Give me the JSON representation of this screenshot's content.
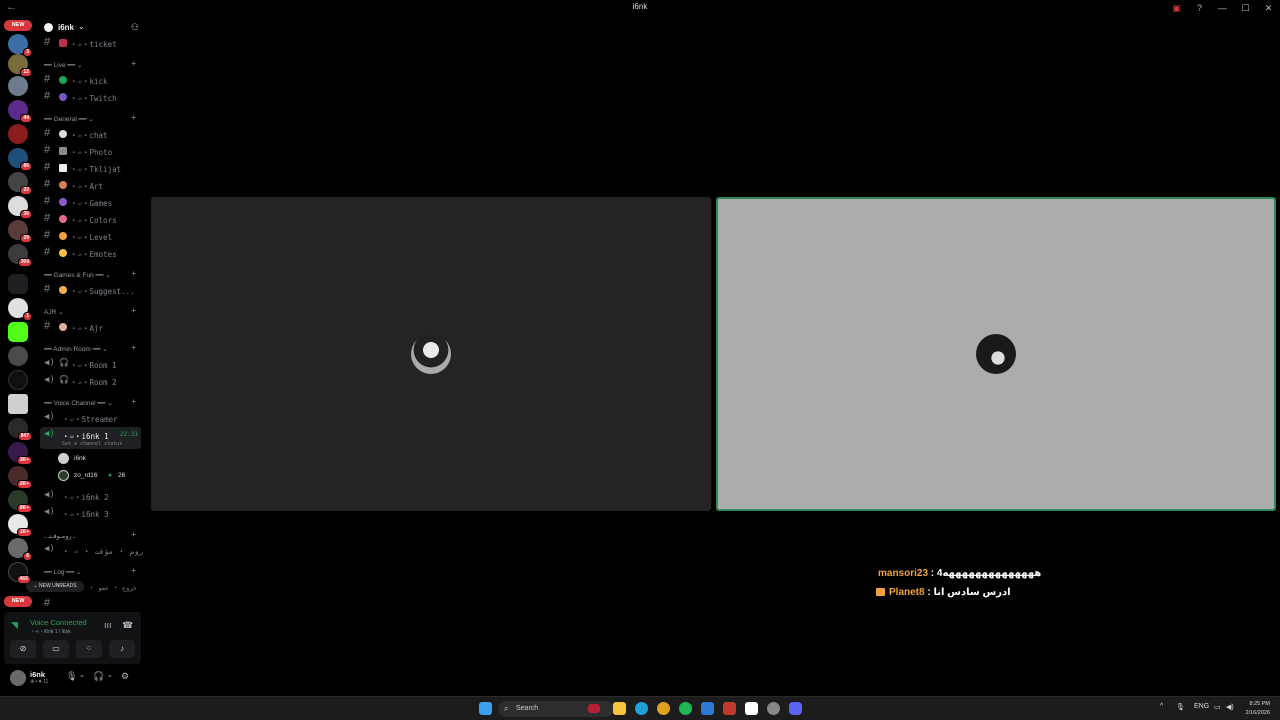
{
  "window": {
    "title": "i6nk",
    "back_glyph": "←"
  },
  "server": {
    "name": "i6nk",
    "dropdown": "⌄"
  },
  "server_badges": [
    "NEW",
    "3",
    "12",
    "44",
    "86",
    "22",
    "36",
    "29",
    "304",
    "1",
    "947",
    "3K+",
    "2K+",
    "9K+",
    "1K+",
    "6",
    "465"
  ],
  "bottom_new": "NEW",
  "categories": {
    "live": "━━ Live ━━ ⌄",
    "general": "━━ General ━━ ⌄",
    "games": "━━ Games & Fun ━━ ⌄",
    "ajr": "AJR ⌄",
    "admin": "━━ Admin Room ━━ ⌄",
    "voice": "━━ Voice Channel ━━ ⌄",
    "arabic": "ـ رومـوقـتـ ـ",
    "log": "━━ Log ━━ ⌄"
  },
  "channels": {
    "ticket": "・➾・ticket",
    "kick": "・➾・kick",
    "twitch": "・➾・Twitch",
    "chat": "・➾・chat",
    "photo": "・➾・Photo",
    "tklijat": "・➾・Tklijat",
    "art": "・➾・Art",
    "games": "・➾・Games",
    "colors": "・➾・Colors",
    "level": "・➾・Level",
    "emotes": "・➾・Emotes",
    "suggest": "・➾・Suggest...",
    "ajr": "・➾・Ajr",
    "room1": "・➾・Room 1",
    "room2": "・➾・Room 2",
    "streamer": "・➾・Streamer",
    "i6nk1": "・➾・i6nk 1",
    "i6nk1_time": "22:31",
    "i6nk1_status": "Set a channel status",
    "i6nk2": "・➾・i6nk 2",
    "i6nk3": "・➾・i6nk 3",
    "arabic_voice": "・ ➾ ・ روم ・ مؤقت",
    "log1": "خروج ・ عضو ・ البـنرقـ",
    "log2": "..."
  },
  "members": [
    {
      "name": "i6nk",
      "extra": ""
    },
    {
      "name": "zo_rd16",
      "extra": "26"
    }
  ],
  "new_unreads": "NEW UNREADS",
  "voice_panel": {
    "connected": "Voice Connected",
    "sub": "・➾・i6nk 1 / i6nk"
  },
  "user": {
    "name": "i6nk",
    "status": "⊕ • ♥ 11"
  },
  "overlay_chat": [
    {
      "user": "mansori23",
      "sep": " : ",
      "msg": "ههههههههههههههه4"
    },
    {
      "user": "Planet8",
      "sep": " : ",
      "msg": "ادرس سادس انا"
    }
  ],
  "taskbar": {
    "search": "Search",
    "lang": "ENG",
    "time": "8:25 PM",
    "date": "2/16/2026"
  },
  "colors": {
    "accent_green": "#23a55a",
    "badge_red": "#da373c",
    "chat_user": "#f0a23b",
    "tile_border": "#2e8b57"
  }
}
